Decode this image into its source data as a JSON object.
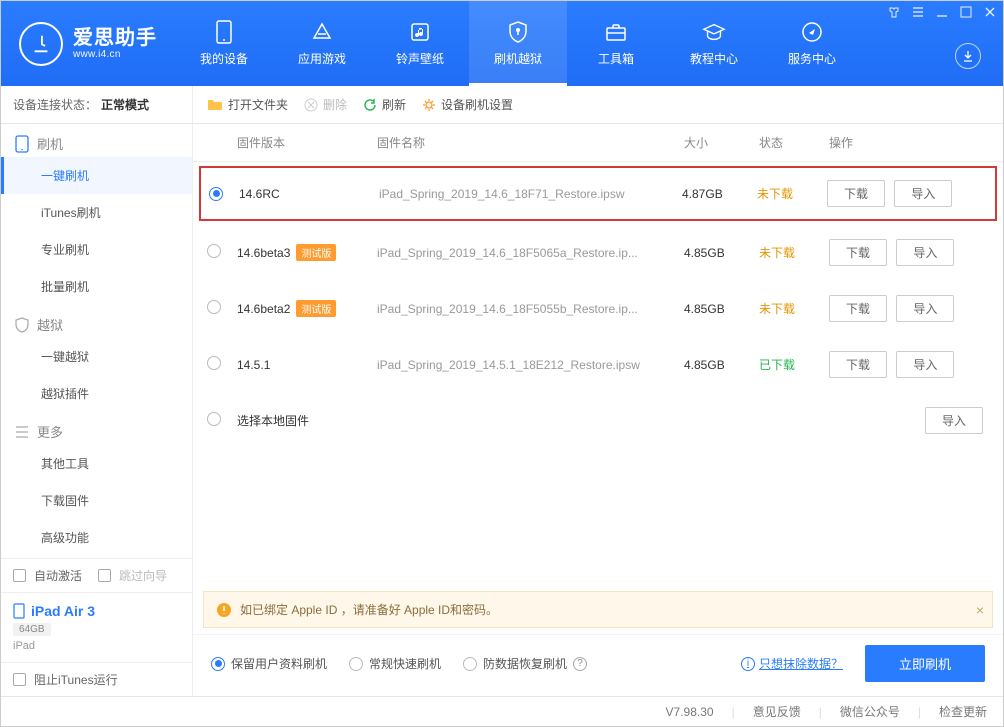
{
  "logo": {
    "title": "爱思助手",
    "sub": "www.i4.cn"
  },
  "nav": {
    "items": [
      {
        "label": "我的设备"
      },
      {
        "label": "应用游戏"
      },
      {
        "label": "铃声壁纸"
      },
      {
        "label": "刷机越狱"
      },
      {
        "label": "工具箱"
      },
      {
        "label": "教程中心"
      },
      {
        "label": "服务中心"
      }
    ]
  },
  "toolbar": {
    "status_label": "设备连接状态：",
    "status_value": "正常模式",
    "open_folder": "打开文件夹",
    "delete": "删除",
    "refresh": "刷新",
    "settings": "设备刷机设置"
  },
  "sidebar": {
    "groups": [
      {
        "title": "刷机",
        "items": [
          "一键刷机",
          "iTunes刷机",
          "专业刷机",
          "批量刷机"
        ]
      },
      {
        "title": "越狱",
        "items": [
          "一键越狱",
          "越狱插件"
        ]
      },
      {
        "title": "更多",
        "items": [
          "其他工具",
          "下载固件",
          "高级功能"
        ]
      }
    ],
    "auto_activate": "自动激活",
    "skip_wizard": "跳过向导"
  },
  "device": {
    "name": "iPad Air 3",
    "storage": "64GB",
    "type": "iPad"
  },
  "stop_itunes": "阻止iTunes运行",
  "table": {
    "headers": {
      "version": "固件版本",
      "name": "固件名称",
      "size": "大小",
      "status": "状态",
      "actions": "操作"
    },
    "download_btn": "下载",
    "import_btn": "导入",
    "beta_badge": "测试版",
    "rows": [
      {
        "version": "14.6RC",
        "name": "iPad_Spring_2019_14.6_18F71_Restore.ipsw",
        "size": "4.87GB",
        "status": "未下载",
        "status_type": "warn",
        "selected": true,
        "badge": false
      },
      {
        "version": "14.6beta3",
        "name": "iPad_Spring_2019_14.6_18F5065a_Restore.ip...",
        "size": "4.85GB",
        "status": "未下载",
        "status_type": "warn",
        "selected": false,
        "badge": true
      },
      {
        "version": "14.6beta2",
        "name": "iPad_Spring_2019_14.6_18F5055b_Restore.ip...",
        "size": "4.85GB",
        "status": "未下载",
        "status_type": "warn",
        "selected": false,
        "badge": true
      },
      {
        "version": "14.5.1",
        "name": "iPad_Spring_2019_14.5.1_18E212_Restore.ipsw",
        "size": "4.85GB",
        "status": "已下载",
        "status_type": "ok",
        "selected": false,
        "badge": false
      }
    ],
    "select_local": "选择本地固件"
  },
  "notice": "如已绑定 Apple ID ，请准备好 Apple ID和密码。",
  "options": {
    "opt1": "保留用户资料刷机",
    "opt2": "常规快速刷机",
    "opt3": "防数据恢复刷机",
    "erase_link": "只想抹除数据？",
    "flash_now": "立即刷机"
  },
  "statusbar": {
    "version": "V7.98.30",
    "feedback": "意见反馈",
    "wechat": "微信公众号",
    "check_update": "检查更新"
  },
  "colors": {
    "primary": "#2a7cff",
    "warn": "#e69500",
    "ok": "#27b34f",
    "highlight_border": "#d63838"
  }
}
